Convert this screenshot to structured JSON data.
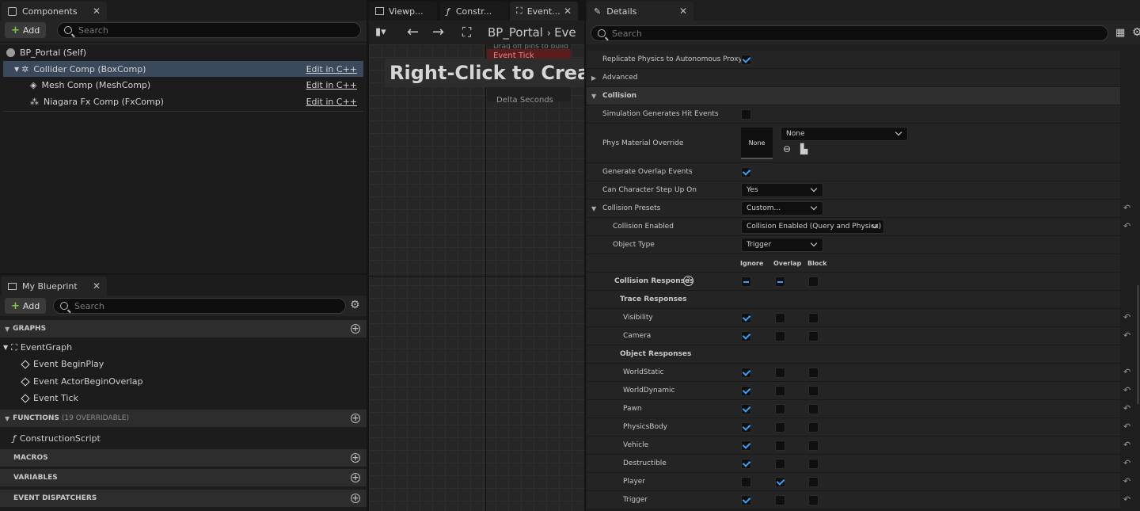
{
  "components_panel": {
    "tab_label": "Components",
    "add_label": "Add",
    "search_placeholder": "Search",
    "items": [
      {
        "label": "BP_Portal (Self)"
      },
      {
        "label": "Collider Comp (BoxComp)",
        "action": "Edit in C++"
      },
      {
        "label": "Mesh Comp (MeshComp)",
        "action": "Edit in C++"
      },
      {
        "label": "Niagara Fx Comp (FxComp)",
        "action": "Edit in C++"
      }
    ]
  },
  "my_blueprint": {
    "tab_label": "My Blueprint",
    "add_label": "Add",
    "search_placeholder": "Search",
    "graphs_header": "GRAPHS",
    "event_graph": "EventGraph",
    "events": [
      "Event BeginPlay",
      "Event ActorBeginOverlap",
      "Event Tick"
    ],
    "functions_header": "FUNCTIONS",
    "functions_count": "(19 OVERRIDABLE)",
    "construction_script": "ConstructionScript",
    "macros_header": "MACROS",
    "variables_header": "VARIABLES",
    "dispatchers_header": "EVENT DISPATCHERS"
  },
  "graph_tabs": [
    "Viewp...",
    "Constr...",
    "Event..."
  ],
  "graph": {
    "breadcrumb": "BP_Portal",
    "breadcrumb_next": "Eve",
    "hint": "Right-Click to Create",
    "node_title": "Event Tick",
    "node_pin": "Delta Seconds",
    "drag_hint": "Drag off pins to build"
  },
  "details": {
    "tab_label": "Details",
    "search_placeholder": "Search",
    "replicate_label": "Replicate Physics to Autonomous Proxy",
    "advanced_label": "Advanced",
    "collision_label": "Collision",
    "sim_hit_label": "Simulation Generates Hit Events",
    "phys_mat_label": "Phys Material Override",
    "phys_mat_thumb": "None",
    "phys_mat_value": "None",
    "gen_overlap_label": "Generate Overlap Events",
    "step_up_label": "Can Character Step Up On",
    "step_up_value": "Yes",
    "presets_label": "Collision Presets",
    "presets_value": "Custom...",
    "enabled_label": "Collision Enabled",
    "enabled_value": "Collision Enabled (Query and Physics)",
    "object_type_label": "Object Type",
    "object_type_value": "Trigger",
    "col_ignore": "Ignore",
    "col_overlap": "Overlap",
    "col_block": "Block",
    "responses_label": "Collision Responses",
    "trace_label": "Trace Responses",
    "object_label": "Object Responses",
    "trace_rows": [
      {
        "label": "Visibility",
        "state": "ignore"
      },
      {
        "label": "Camera",
        "state": "ignore"
      }
    ],
    "object_rows": [
      {
        "label": "WorldStatic",
        "state": "ignore"
      },
      {
        "label": "WorldDynamic",
        "state": "ignore"
      },
      {
        "label": "Pawn",
        "state": "ignore"
      },
      {
        "label": "PhysicsBody",
        "state": "ignore"
      },
      {
        "label": "Vehicle",
        "state": "ignore"
      },
      {
        "label": "Destructible",
        "state": "ignore"
      },
      {
        "label": "Player",
        "state": "overlap"
      },
      {
        "label": "Trigger",
        "state": "ignore"
      }
    ]
  },
  "colors": {
    "accent": "#3aa0ff",
    "selection": "#3a4a5c",
    "add_green": "#7ec94a"
  }
}
